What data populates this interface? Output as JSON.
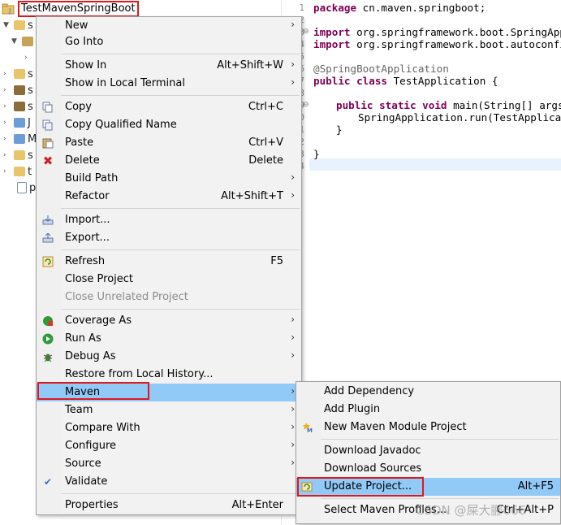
{
  "explorer": {
    "project_name": "TestMavenSpringBoot",
    "tree_items": [
      "s",
      "s",
      "s",
      "s",
      "J",
      "M",
      "s",
      "t",
      "p"
    ]
  },
  "editor": {
    "line_numbers": [
      "1",
      "2",
      "3",
      "4",
      "5",
      "6",
      "7",
      "8",
      "9",
      "10",
      "11",
      "12",
      "13",
      "14"
    ],
    "lines": [
      {
        "kw": "package",
        "rest": " cn.maven.springboot;"
      },
      {
        "kw": "",
        "rest": ""
      },
      {
        "kw": "import",
        "rest": " org.springframework.boot.SpringApplic"
      },
      {
        "kw": "import",
        "rest": " org.springframework.boot.autoconfigur"
      },
      {
        "kw": "",
        "rest": ""
      },
      {
        "kw": "",
        "rest": "@SpringBootApplication"
      },
      {
        "kw": "public class",
        "rest": " TestApplication {"
      },
      {
        "kw": "",
        "rest": ""
      },
      {
        "kw": "public static void",
        "rest": " main(String[] args) {"
      },
      {
        "kw": "",
        "rest": "SpringApplication.run(TestApplicatio"
      },
      {
        "kw": "",
        "rest": "}"
      },
      {
        "kw": "",
        "rest": ""
      },
      {
        "kw": "",
        "rest": "}"
      },
      {
        "kw": "",
        "rest": ""
      }
    ]
  },
  "context_menu": {
    "new": "New",
    "go_into": "Go Into",
    "show_in": "Show In",
    "show_in_shortcut": "Alt+Shift+W",
    "show_in_terminal": "Show in Local Terminal",
    "copy": "Copy",
    "copy_shortcut": "Ctrl+C",
    "copy_qualified": "Copy Qualified Name",
    "paste": "Paste",
    "paste_shortcut": "Ctrl+V",
    "delete": "Delete",
    "delete_shortcut": "Delete",
    "build_path": "Build Path",
    "refactor": "Refactor",
    "refactor_shortcut": "Alt+Shift+T",
    "import": "Import...",
    "export": "Export...",
    "refresh": "Refresh",
    "refresh_shortcut": "F5",
    "close_project": "Close Project",
    "close_unrelated": "Close Unrelated Project",
    "coverage_as": "Coverage As",
    "run_as": "Run As",
    "debug_as": "Debug As",
    "restore_history": "Restore from Local History...",
    "maven": "Maven",
    "team": "Team",
    "compare_with": "Compare With",
    "configure": "Configure",
    "source": "Source",
    "validate": "Validate",
    "properties": "Properties",
    "properties_shortcut": "Alt+Enter"
  },
  "maven_menu": {
    "add_dependency": "Add Dependency",
    "add_plugin": "Add Plugin",
    "new_module": "New Maven Module Project",
    "download_javadoc": "Download Javadoc",
    "download_sources": "Download Sources",
    "update_project": "Update Project...",
    "update_shortcut": "Alt+F5",
    "select_profiles": "Select Maven Profiles...",
    "select_profiles_shortcut": "Ctrl+Alt+P"
  },
  "watermark": "CSDN @屎大郦666",
  "colors": {
    "highlight": "#91c9f7",
    "annotation_red": "#e0181e",
    "keyword": "#7f0055"
  }
}
